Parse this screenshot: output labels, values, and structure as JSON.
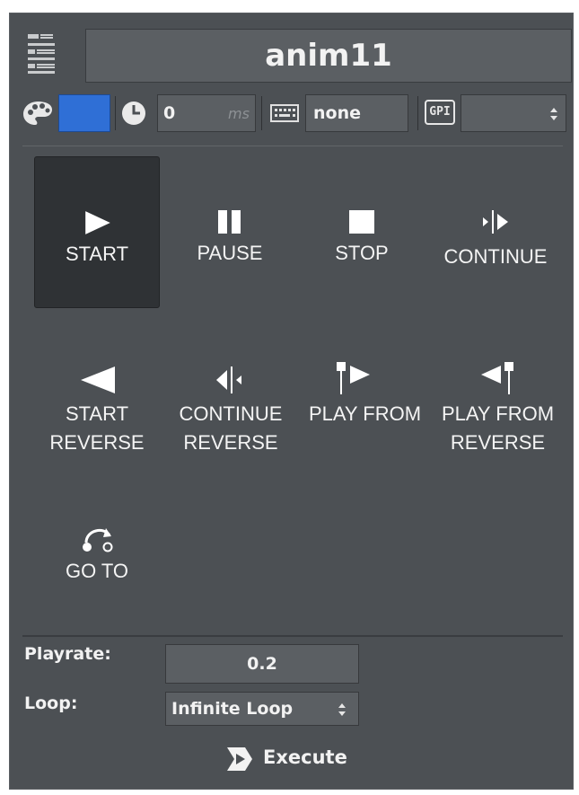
{
  "title": "anim11",
  "toolbar": {
    "color_swatch": "#2f6fd6",
    "delay_value": "0",
    "delay_unit": "ms",
    "keyboard_value": "none",
    "gpi_label": "GPI",
    "gpi_select_value": ""
  },
  "buttons": {
    "start": "START",
    "pause": "PAUSE",
    "stop": "STOP",
    "continue": "CONTINUE",
    "start_reverse_1": "START",
    "start_reverse_2": "REVERSE",
    "continue_reverse_1": "CONTINUE",
    "continue_reverse_2": "REVERSE",
    "play_from": "PLAY FROM",
    "play_from_reverse_1": "PLAY FROM",
    "play_from_reverse_2": "REVERSE",
    "go_to": "GO TO"
  },
  "properties": {
    "playrate_label": "Playrate:",
    "playrate_value": "0.2",
    "loop_label": "Loop:",
    "loop_value": "Infinite Loop"
  },
  "execute_label": "Execute",
  "colors": {
    "panel_bg": "#4c5054",
    "field_bg": "#5b5f63",
    "active_bg": "#2f3235",
    "text": "#f2f2f2",
    "swatch": "#2f6fd6"
  }
}
